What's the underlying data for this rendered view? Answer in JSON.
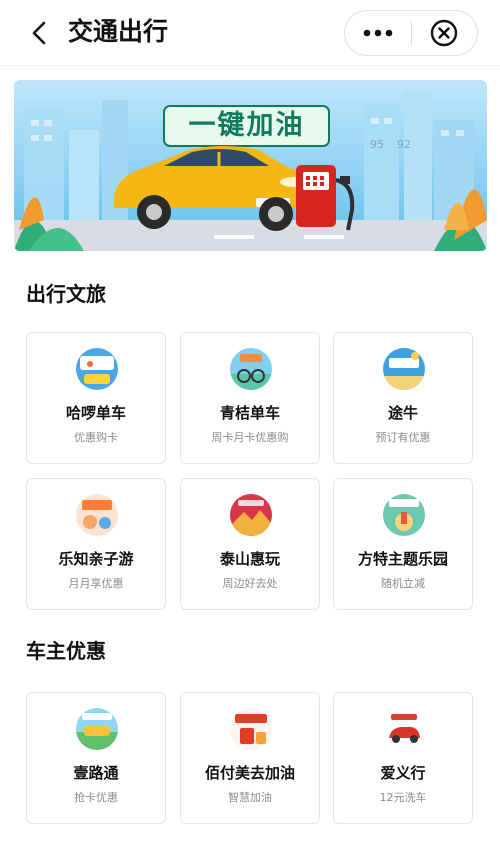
{
  "header": {
    "title": "交通出行",
    "more_icon": "more-dots-icon",
    "close_icon": "close-circle-icon"
  },
  "banner": {
    "headline": "一键加油",
    "pump_numbers": [
      "95",
      "92"
    ]
  },
  "sections": [
    {
      "title": "出行文旅",
      "items": [
        {
          "name": "哈啰单车",
          "desc": "优惠购卡"
        },
        {
          "name": "青桔单车",
          "desc": "周卡月卡优惠购"
        },
        {
          "name": "途牛",
          "desc": "预订有优惠"
        },
        {
          "name": "乐知亲子游",
          "desc": "月月享优惠"
        },
        {
          "name": "泰山惠玩",
          "desc": "周边好去处"
        },
        {
          "name": "方特主题乐园",
          "desc": "随机立减"
        }
      ]
    },
    {
      "title": "车主优惠",
      "items": [
        {
          "name": "壹路通",
          "desc": "抢卡优惠"
        },
        {
          "name": "佰付美去加油",
          "desc": "智慧加油"
        },
        {
          "name": "爱义行",
          "desc": "12元洗车"
        }
      ]
    }
  ],
  "colors": {
    "banner_sky": "#8fd0f4",
    "car_yellow": "#f5b716",
    "pump_red": "#d7261e",
    "headline_green": "#0f7a5c"
  }
}
